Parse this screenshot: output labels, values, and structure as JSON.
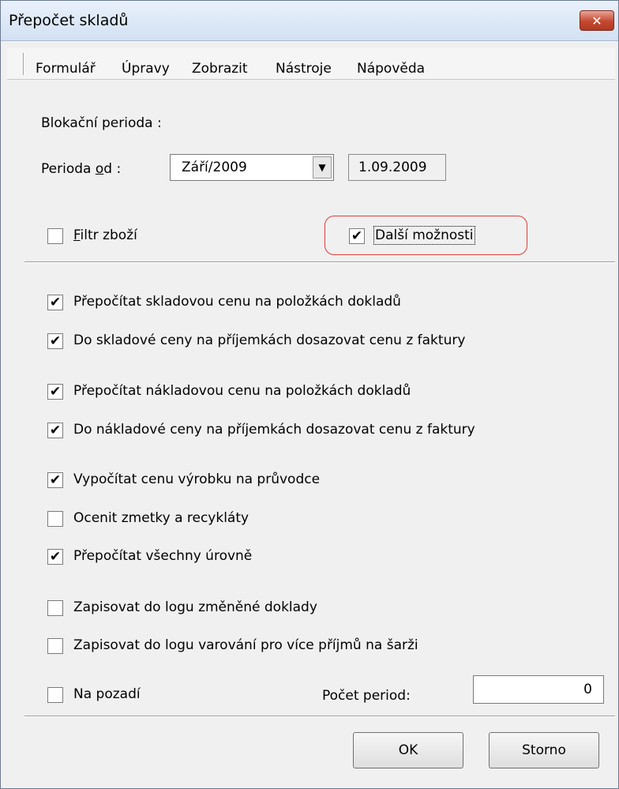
{
  "window": {
    "title": "Přepočet skladů",
    "close_label": "✕"
  },
  "menu": [
    "Formulář",
    "Úpravy",
    "Zobrazit",
    "Nástroje",
    "Nápověda"
  ],
  "blocking_period_label": "Blokační perioda :",
  "period": {
    "label_pre": "Perioda ",
    "label_u": "o",
    "label_post": "d :",
    "selected": "Září/2009",
    "date": "1.09.2009"
  },
  "filter": {
    "label_u": "F",
    "label_rest": "iltr zboží",
    "checked": false
  },
  "more_options": {
    "label": "Další možnosti",
    "checked": true
  },
  "options": [
    {
      "label": "Přepočítat skladovou cenu na položkách dokladů",
      "checked": true
    },
    {
      "label": "Do skladové ceny na příjemkách dosazovat cenu z faktury",
      "checked": true
    },
    {
      "label": "Přepočítat nákladovou cenu na položkách dokladů",
      "checked": true
    },
    {
      "label": "Do nákladové ceny na příjemkách dosazovat cenu z faktury",
      "checked": true
    },
    {
      "label": "Vypočítat cenu výrobku na průvodce",
      "checked": true
    },
    {
      "label": "Ocenit zmetky a recykláty",
      "checked": false
    },
    {
      "label": "Přepočítat všechny úrovně",
      "checked": true
    },
    {
      "label": "Zapisovat do logu změněné doklady",
      "checked": false
    },
    {
      "label": "Zapisovat do logu varování pro více příjmů na šarži",
      "checked": false
    },
    {
      "label": "Na pozadí",
      "checked": false
    }
  ],
  "period_count": {
    "label": "Počet period:",
    "value": "0"
  },
  "buttons": {
    "ok": "OK",
    "cancel": "Storno"
  }
}
